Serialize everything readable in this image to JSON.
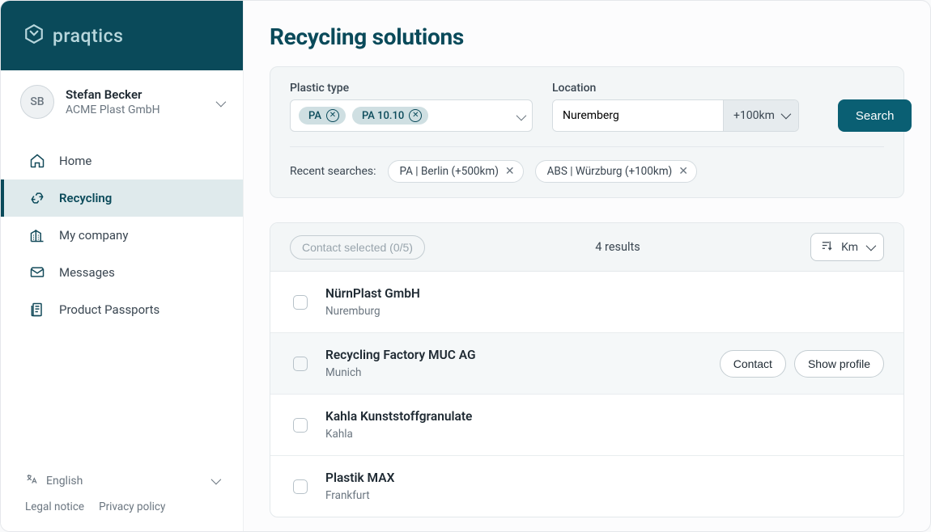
{
  "brand": {
    "name": "praqtics"
  },
  "user": {
    "initials": "SB",
    "name": "Stefan Becker",
    "company": "ACME Plast GmbH"
  },
  "nav": [
    {
      "key": "home",
      "label": "Home"
    },
    {
      "key": "recycling",
      "label": "Recycling"
    },
    {
      "key": "my-company",
      "label": "My company"
    },
    {
      "key": "messages",
      "label": "Messages"
    },
    {
      "key": "product-passports",
      "label": "Product Passports"
    }
  ],
  "nav_active": "recycling",
  "footer": {
    "language": "English",
    "links": [
      {
        "key": "legal",
        "label": "Legal notice"
      },
      {
        "key": "privacy",
        "label": "Privacy policy"
      }
    ]
  },
  "page": {
    "title": "Recycling solutions"
  },
  "search": {
    "plastic_label": "Plastic type",
    "plastic_chips": [
      "PA",
      "PA 10.10"
    ],
    "location_label": "Location",
    "location_value": "Nuremberg",
    "distance": "+100km",
    "button": "Search",
    "recent_label": "Recent searches:",
    "recent": [
      "PA | Berlin (+500km)",
      "ABS | Würzburg (+100km)"
    ]
  },
  "results": {
    "contact_selected_label": "Contact selected (0/5)",
    "count_text": "4 results",
    "sort_label": "Km",
    "contact_btn": "Contact",
    "show_profile_btn": "Show profile",
    "items": [
      {
        "name": "NürnPlast GmbH",
        "location": "Nuremburg",
        "hover": false
      },
      {
        "name": "Recycling Factory MUC AG",
        "location": "Munich",
        "hover": true
      },
      {
        "name": "Kahla Kunststoffgranulate",
        "location": "Kahla",
        "hover": false
      },
      {
        "name": "Plastik MAX",
        "location": "Frankfurt",
        "hover": false
      }
    ]
  }
}
